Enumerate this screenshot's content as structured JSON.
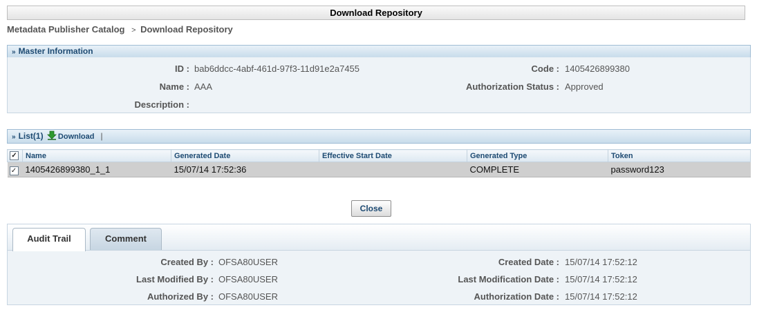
{
  "page_title": "Download Repository",
  "breadcrumb": {
    "root": "Metadata Publisher Catalog",
    "separator": ">",
    "current": "Download Repository"
  },
  "master": {
    "header": "Master Information",
    "id_label": "ID :",
    "id_value": "bab6ddcc-4abf-461d-97f3-11d91e2a7455",
    "code_label": "Code :",
    "code_value": "1405426899380",
    "name_label": "Name :",
    "name_value": "AAA",
    "auth_status_label": "Authorization Status :",
    "auth_status_value": "Approved",
    "description_label": "Description :",
    "description_value": ""
  },
  "list": {
    "header": "List(1)",
    "download_label": "Download",
    "divider": "|",
    "columns": [
      "Name",
      "Generated Date",
      "Effective Start Date",
      "Generated Type",
      "Token"
    ],
    "rows": [
      {
        "checked": true,
        "cells": [
          "1405426899380_1_1",
          "15/07/14 17:52:36",
          "",
          "COMPLETE",
          "password123"
        ]
      }
    ]
  },
  "close_label": "Close",
  "tabs": [
    {
      "label": "Audit Trail",
      "active": true
    },
    {
      "label": "Comment",
      "active": false
    }
  ],
  "audit": {
    "created_by_label": "Created By :",
    "created_by_value": "OFSA80USER",
    "created_date_label": "Created Date :",
    "created_date_value": "15/07/14 17:52:12",
    "last_modified_by_label": "Last Modified By :",
    "last_modified_by_value": "OFSA80USER",
    "last_mod_date_label": "Last Modification Date :",
    "last_mod_date_value": "15/07/14 17:52:12",
    "authorized_by_label": "Authorized By :",
    "authorized_by_value": "OFSA80USER",
    "auth_date_label": "Authorization Date :",
    "auth_date_value": "15/07/14 17:52:12"
  },
  "icons": {
    "collapse": "double-chevron-down-icon",
    "download": "green-download-arrow-icon",
    "checkbox": "checkbox-icon"
  },
  "colors": {
    "header_text": "#1d4a72",
    "panel_bg": "#eef3f7",
    "download_green": "#2e9a2e"
  }
}
